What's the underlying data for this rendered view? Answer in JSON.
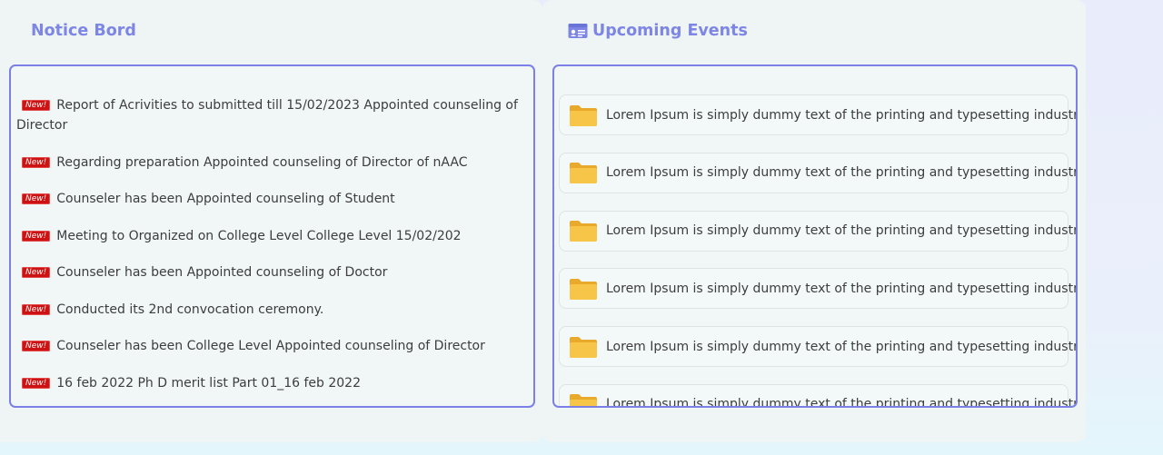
{
  "notice_board": {
    "title": "Notice Bord",
    "badge_label": "New!",
    "items": [
      "Report of Acrivities to submitted till 15/02/2023 Appointed counseling of Director",
      "Regarding preparation Appointed counseling of Director of nAAC",
      "Counseler has been Appointed counseling of Student",
      "Meeting to Organized on College Level College Level 15/02/202",
      "Counseler has been Appointed counseling of Doctor",
      "Conducted its 2nd convocation ceremony.",
      "Counseler has been College Level Appointed counseling of Director",
      "16 feb 2022 Ph D merit list Part 01_16 feb 2022"
    ]
  },
  "upcoming_events": {
    "title": "Upcoming Events",
    "title_icon": "id-card-icon",
    "item_icon": "folder-icon",
    "items": [
      "Lorem Ipsum is simply dummy text of the printing and typesetting industry.",
      "Lorem Ipsum is simply dummy text of the printing and typesetting industry.",
      "Lorem Ipsum is simply dummy text of the printing and typesetting industry.",
      "Lorem Ipsum is simply dummy text of the printing and typesetting industry.",
      "Lorem Ipsum is simply dummy text of the printing and typesetting industry.",
      "Lorem Ipsum is simply dummy text of the printing and typesetting industry."
    ]
  },
  "colors": {
    "accent": "#7d86e4",
    "border": "#7c80e6",
    "badge": "#cc1212",
    "folder": "#f6c343"
  }
}
